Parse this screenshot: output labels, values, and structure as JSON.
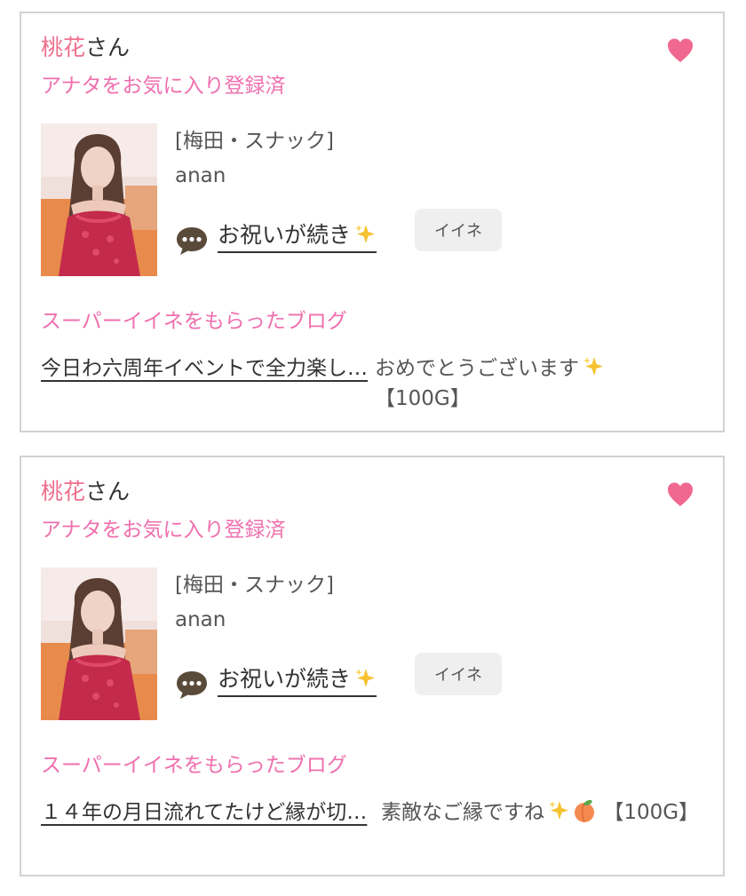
{
  "cards": [
    {
      "user_name": "桃花",
      "user_suffix": "さん",
      "favorite_status": "アナタをお気に入り登録済",
      "shop": "[梅田・スナック]",
      "cast_name": "anan",
      "message_link": "お祝いが続き",
      "like_button": "イイネ",
      "super_like_title": "スーパーイイネをもらったブログ",
      "blog_title": "今日わ六周年イベントで全力楽し…",
      "comment": "おめでとうございます",
      "comment_suffix": "【100G】",
      "icons": [
        "heart-icon",
        "speech-bubble-icon",
        "sparkle-emoji"
      ]
    },
    {
      "user_name": "桃花",
      "user_suffix": "さん",
      "favorite_status": "アナタをお気に入り登録済",
      "shop": "[梅田・スナック]",
      "cast_name": "anan",
      "message_link": "お祝いが続き",
      "like_button": "イイネ",
      "super_like_title": "スーパーイイネをもらったブログ",
      "blog_title": "１４年の月日流れてたけど縁が切…",
      "comment": "素敵なご縁ですね",
      "comment_suffix": "【100G】",
      "icons": [
        "heart-icon",
        "speech-bubble-icon",
        "sparkle-emoji",
        "peach-emoji"
      ]
    }
  ],
  "colors": {
    "pink_name": "#ef6f8c",
    "pink_text": "#ef6fae",
    "heart": "#f06890",
    "border": "#d2d2d2",
    "button_bg": "#efefef"
  }
}
